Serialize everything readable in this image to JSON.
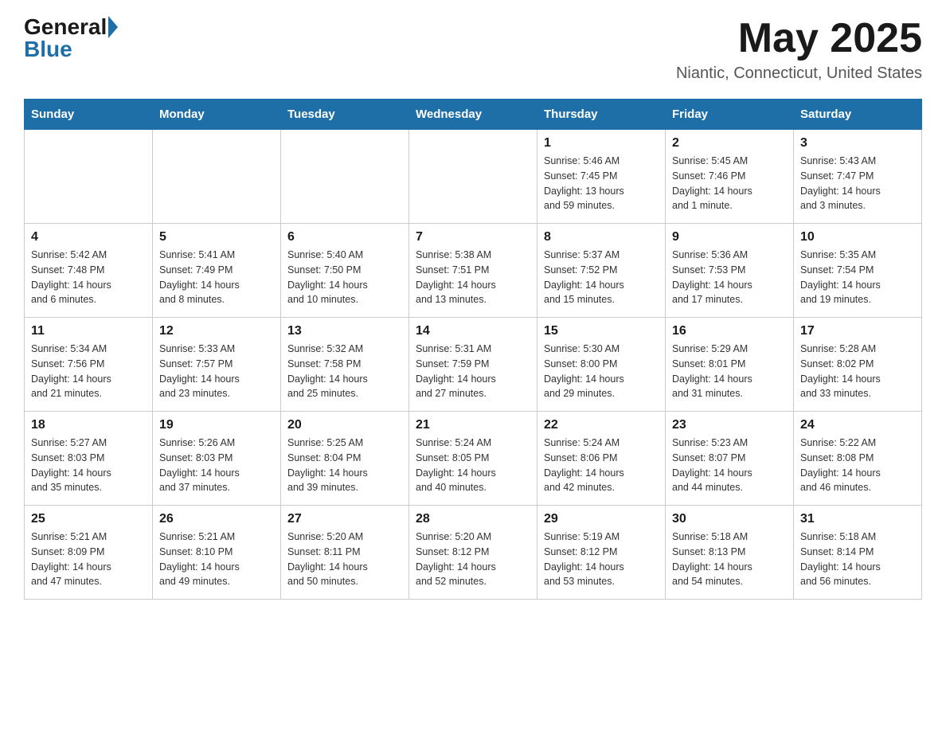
{
  "header": {
    "logo_general": "General",
    "logo_blue": "Blue",
    "month_year": "May 2025",
    "location": "Niantic, Connecticut, United States"
  },
  "days_of_week": [
    "Sunday",
    "Monday",
    "Tuesday",
    "Wednesday",
    "Thursday",
    "Friday",
    "Saturday"
  ],
  "weeks": [
    [
      {
        "day": "",
        "info": ""
      },
      {
        "day": "",
        "info": ""
      },
      {
        "day": "",
        "info": ""
      },
      {
        "day": "",
        "info": ""
      },
      {
        "day": "1",
        "info": "Sunrise: 5:46 AM\nSunset: 7:45 PM\nDaylight: 13 hours\nand 59 minutes."
      },
      {
        "day": "2",
        "info": "Sunrise: 5:45 AM\nSunset: 7:46 PM\nDaylight: 14 hours\nand 1 minute."
      },
      {
        "day": "3",
        "info": "Sunrise: 5:43 AM\nSunset: 7:47 PM\nDaylight: 14 hours\nand 3 minutes."
      }
    ],
    [
      {
        "day": "4",
        "info": "Sunrise: 5:42 AM\nSunset: 7:48 PM\nDaylight: 14 hours\nand 6 minutes."
      },
      {
        "day": "5",
        "info": "Sunrise: 5:41 AM\nSunset: 7:49 PM\nDaylight: 14 hours\nand 8 minutes."
      },
      {
        "day": "6",
        "info": "Sunrise: 5:40 AM\nSunset: 7:50 PM\nDaylight: 14 hours\nand 10 minutes."
      },
      {
        "day": "7",
        "info": "Sunrise: 5:38 AM\nSunset: 7:51 PM\nDaylight: 14 hours\nand 13 minutes."
      },
      {
        "day": "8",
        "info": "Sunrise: 5:37 AM\nSunset: 7:52 PM\nDaylight: 14 hours\nand 15 minutes."
      },
      {
        "day": "9",
        "info": "Sunrise: 5:36 AM\nSunset: 7:53 PM\nDaylight: 14 hours\nand 17 minutes."
      },
      {
        "day": "10",
        "info": "Sunrise: 5:35 AM\nSunset: 7:54 PM\nDaylight: 14 hours\nand 19 minutes."
      }
    ],
    [
      {
        "day": "11",
        "info": "Sunrise: 5:34 AM\nSunset: 7:56 PM\nDaylight: 14 hours\nand 21 minutes."
      },
      {
        "day": "12",
        "info": "Sunrise: 5:33 AM\nSunset: 7:57 PM\nDaylight: 14 hours\nand 23 minutes."
      },
      {
        "day": "13",
        "info": "Sunrise: 5:32 AM\nSunset: 7:58 PM\nDaylight: 14 hours\nand 25 minutes."
      },
      {
        "day": "14",
        "info": "Sunrise: 5:31 AM\nSunset: 7:59 PM\nDaylight: 14 hours\nand 27 minutes."
      },
      {
        "day": "15",
        "info": "Sunrise: 5:30 AM\nSunset: 8:00 PM\nDaylight: 14 hours\nand 29 minutes."
      },
      {
        "day": "16",
        "info": "Sunrise: 5:29 AM\nSunset: 8:01 PM\nDaylight: 14 hours\nand 31 minutes."
      },
      {
        "day": "17",
        "info": "Sunrise: 5:28 AM\nSunset: 8:02 PM\nDaylight: 14 hours\nand 33 minutes."
      }
    ],
    [
      {
        "day": "18",
        "info": "Sunrise: 5:27 AM\nSunset: 8:03 PM\nDaylight: 14 hours\nand 35 minutes."
      },
      {
        "day": "19",
        "info": "Sunrise: 5:26 AM\nSunset: 8:03 PM\nDaylight: 14 hours\nand 37 minutes."
      },
      {
        "day": "20",
        "info": "Sunrise: 5:25 AM\nSunset: 8:04 PM\nDaylight: 14 hours\nand 39 minutes."
      },
      {
        "day": "21",
        "info": "Sunrise: 5:24 AM\nSunset: 8:05 PM\nDaylight: 14 hours\nand 40 minutes."
      },
      {
        "day": "22",
        "info": "Sunrise: 5:24 AM\nSunset: 8:06 PM\nDaylight: 14 hours\nand 42 minutes."
      },
      {
        "day": "23",
        "info": "Sunrise: 5:23 AM\nSunset: 8:07 PM\nDaylight: 14 hours\nand 44 minutes."
      },
      {
        "day": "24",
        "info": "Sunrise: 5:22 AM\nSunset: 8:08 PM\nDaylight: 14 hours\nand 46 minutes."
      }
    ],
    [
      {
        "day": "25",
        "info": "Sunrise: 5:21 AM\nSunset: 8:09 PM\nDaylight: 14 hours\nand 47 minutes."
      },
      {
        "day": "26",
        "info": "Sunrise: 5:21 AM\nSunset: 8:10 PM\nDaylight: 14 hours\nand 49 minutes."
      },
      {
        "day": "27",
        "info": "Sunrise: 5:20 AM\nSunset: 8:11 PM\nDaylight: 14 hours\nand 50 minutes."
      },
      {
        "day": "28",
        "info": "Sunrise: 5:20 AM\nSunset: 8:12 PM\nDaylight: 14 hours\nand 52 minutes."
      },
      {
        "day": "29",
        "info": "Sunrise: 5:19 AM\nSunset: 8:12 PM\nDaylight: 14 hours\nand 53 minutes."
      },
      {
        "day": "30",
        "info": "Sunrise: 5:18 AM\nSunset: 8:13 PM\nDaylight: 14 hours\nand 54 minutes."
      },
      {
        "day": "31",
        "info": "Sunrise: 5:18 AM\nSunset: 8:14 PM\nDaylight: 14 hours\nand 56 minutes."
      }
    ]
  ]
}
